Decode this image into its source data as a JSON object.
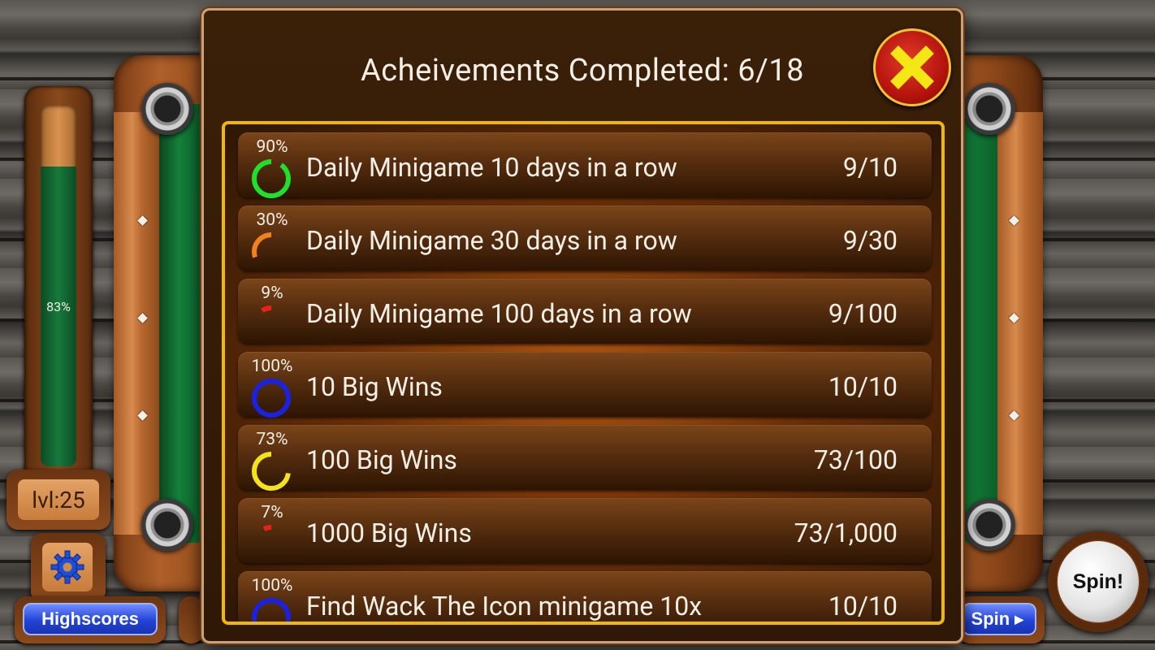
{
  "hud": {
    "xp_percent_label": "83%",
    "xp_fraction": 0.83,
    "level_label": "lvl:25",
    "settings_icon": "gear-icon",
    "highscores_label": "Highscores",
    "spin_tab_label": "Spin",
    "spin_button_label": "Spin!"
  },
  "dialog": {
    "title": "Acheivements Completed: 6/18",
    "close_icon": "close-x-icon"
  },
  "achievements": [
    {
      "percent_label": "90%",
      "fraction": 0.9,
      "color": "#22e02a",
      "name": "Daily Minigame 10 days in a row",
      "progress": "9/10"
    },
    {
      "percent_label": "30%",
      "fraction": 0.3,
      "color": "#f0821e",
      "name": "Daily Minigame 30 days in a row",
      "progress": "9/30"
    },
    {
      "percent_label": "9%",
      "fraction": 0.09,
      "color": "#e8221a",
      "name": "Daily Minigame 100 days in a row",
      "progress": "9/100"
    },
    {
      "percent_label": "100%",
      "fraction": 1.0,
      "color": "#1a22e0",
      "name": "10 Big Wins",
      "progress": "10/10"
    },
    {
      "percent_label": "73%",
      "fraction": 0.73,
      "color": "#f2e31c",
      "name": "100 Big Wins",
      "progress": "73/100"
    },
    {
      "percent_label": "7%",
      "fraction": 0.07,
      "color": "#e8221a",
      "name": "1000 Big Wins",
      "progress": "73/1,000"
    },
    {
      "percent_label": "100%",
      "fraction": 1.0,
      "color": "#1a22e0",
      "name": "Find Wack The Icon minigame 10x",
      "progress": "10/10"
    }
  ]
}
